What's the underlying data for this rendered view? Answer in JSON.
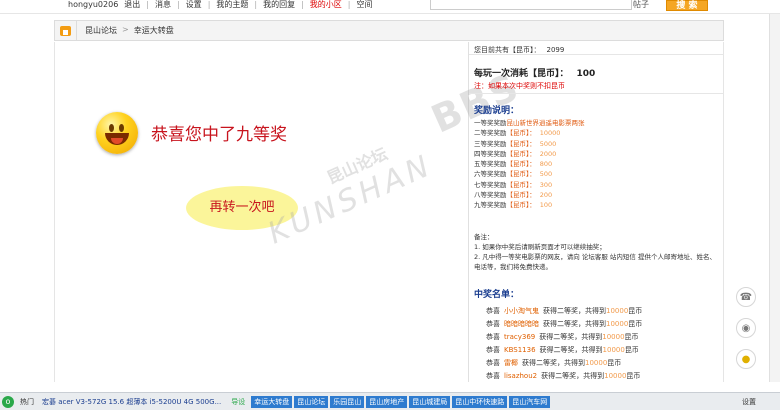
{
  "topbar": {
    "username": "hongyu0206",
    "links": [
      "退出",
      "消息",
      "设置",
      "我的主题",
      "我的回复",
      "我的小区",
      "空间"
    ],
    "search_type": "帖子",
    "search_btn": "搜 索"
  },
  "breadcrumb": {
    "forum": "昆山论坛",
    "arrow": ">",
    "page": "幸运大转盘"
  },
  "game": {
    "win_text": "恭喜您中了九等奖",
    "again_label": "再转一次吧"
  },
  "watermark": {
    "cn": "昆山论坛",
    "en": "KUNSHAN",
    "bbs": "BBS"
  },
  "info": {
    "coins_label": "您目前共有【昆币】：",
    "coins_value": "2099",
    "cost_label": "每玩一次消耗【昆币】：",
    "cost_value": "100",
    "note": "注：如果本次中奖则不扣昆币",
    "prize_title": "奖励说明：",
    "prizes": [
      {
        "k": "一等奖奖励",
        "a": "昆山新世界逍遥电影票两张",
        "unit": ""
      },
      {
        "k": "二等奖奖励",
        "a": "【昆币】：",
        "unit": "10000"
      },
      {
        "k": "三等奖奖励",
        "a": "【昆币】：",
        "unit": "5000"
      },
      {
        "k": "四等奖奖励",
        "a": "【昆币】：",
        "unit": "2000"
      },
      {
        "k": "五等奖奖励",
        "a": "【昆币】：",
        "unit": "800"
      },
      {
        "k": "六等奖奖励",
        "a": "【昆币】：",
        "unit": "500"
      },
      {
        "k": "七等奖奖励",
        "a": "【昆币】：",
        "unit": "300"
      },
      {
        "k": "八等奖奖励",
        "a": "【昆币】：",
        "unit": "200"
      },
      {
        "k": "九等奖奖励",
        "a": "【昆币】：",
        "unit": "100"
      }
    ],
    "remark_title": "备注：",
    "remarks": [
      "1. 如果你中奖后请刷新页面才可以继续抽奖；",
      "2. 凡中得一等奖电影票的网友，请向 论坛客服 站内短信 提供个人邮寄地址、姓名、电话等，我们将免费快递。"
    ],
    "winners_title": "中奖名单：",
    "winners": [
      {
        "p": "恭喜",
        "n": "小小淘气鬼",
        "t": "获得二等奖，共得到",
        "amt": "10000",
        "u": "昆币"
      },
      {
        "p": "恭喜",
        "n": "暗暗暗暗暗",
        "t": "获得二等奖，共得到",
        "amt": "10000",
        "u": "昆币"
      },
      {
        "p": "恭喜",
        "n": "tracy369",
        "t": "获得二等奖，共得到",
        "amt": "10000",
        "u": "昆币"
      },
      {
        "p": "恭喜",
        "n": "KBS1136",
        "t": "获得二等奖，共得到",
        "amt": "10000",
        "u": "昆币"
      },
      {
        "p": "恭喜",
        "n": "雷椰",
        "t": "获得二等奖，共得到",
        "amt": "10000",
        "u": "昆币"
      },
      {
        "p": "恭喜",
        "n": "lisazhou2",
        "t": "获得二等奖，共得到",
        "amt": "10000",
        "u": "昆币"
      }
    ]
  },
  "taskbar": {
    "hot": "热门",
    "ad": "宏碁 acer V3-572G 15.6 超薄本 i5-5200U 4G 500G...",
    "tag": "导设",
    "tabs": [
      "幸运大转盘",
      "昆山论坛",
      "乐园昆山",
      "昆山房地产",
      "昆山城建局",
      "昆山中环快速路",
      "昆山汽车网"
    ],
    "right": "设置"
  }
}
